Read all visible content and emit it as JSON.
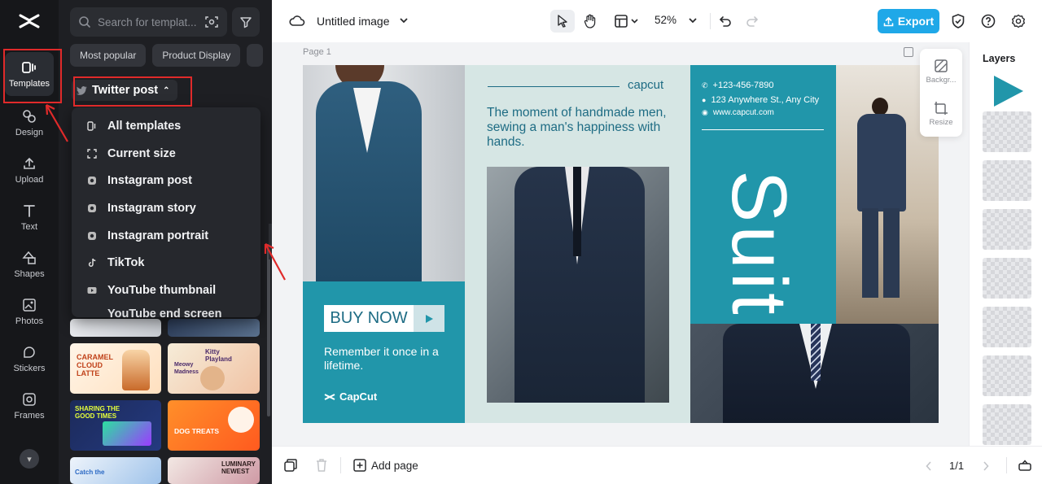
{
  "rail": {
    "items": [
      {
        "label": "Templates",
        "icon": "templates-icon"
      },
      {
        "label": "Design",
        "icon": "design-icon"
      },
      {
        "label": "Upload",
        "icon": "upload-icon"
      },
      {
        "label": "Text",
        "icon": "text-icon"
      },
      {
        "label": "Shapes",
        "icon": "shapes-icon"
      },
      {
        "label": "Photos",
        "icon": "photos-icon"
      },
      {
        "label": "Stickers",
        "icon": "stickers-icon"
      },
      {
        "label": "Frames",
        "icon": "frames-icon"
      }
    ]
  },
  "panel": {
    "search_placeholder": "Search for templat...",
    "chips": [
      "Most popular",
      "Product Display"
    ],
    "size_dropdown": "Twitter post",
    "menu": [
      "All templates",
      "Current size",
      "Instagram post",
      "Instagram story",
      "Instagram portrait",
      "TikTok",
      "YouTube thumbnail",
      "YouTube end screen"
    ],
    "thumbs": {
      "caramel": "CARAMEL CLOUD LATTE",
      "kitty_title": "Kitty Playland",
      "kitty_sub": "Meowy Madness",
      "sharing": "SHARING THE GOOD TIMES",
      "dog": "DOG TREATS",
      "catch": "Catch the",
      "luminary": "LUMINARY NEWEST"
    }
  },
  "topbar": {
    "title": "Untitled image",
    "zoom": "52%",
    "export": "Export"
  },
  "canvas": {
    "page_label": "Page 1",
    "tools": [
      {
        "label": "Backgr...",
        "icon": "background-icon"
      },
      {
        "label": "Resize",
        "icon": "resize-icon"
      }
    ]
  },
  "design": {
    "brand_small": "capcut",
    "tagline": "The moment of handmade men, sewing a man's happiness with hands.",
    "phone": "+123-456-7890",
    "address": "123 Anywhere St., Any City",
    "website": "www.capcut.com",
    "big_word": "Suit",
    "buy_now": "BUY NOW",
    "remember": "Remember it once in a lifetime.",
    "logo": "CapCut",
    "colors": {
      "teal": "#2196aa",
      "mint": "#d6e6e4",
      "navy": "#1e2c40"
    }
  },
  "layers": {
    "title": "Layers",
    "count": 8
  },
  "bottombar": {
    "add_page": "Add page",
    "page_count": "1/1"
  },
  "annotations_color": "#e02a2a"
}
